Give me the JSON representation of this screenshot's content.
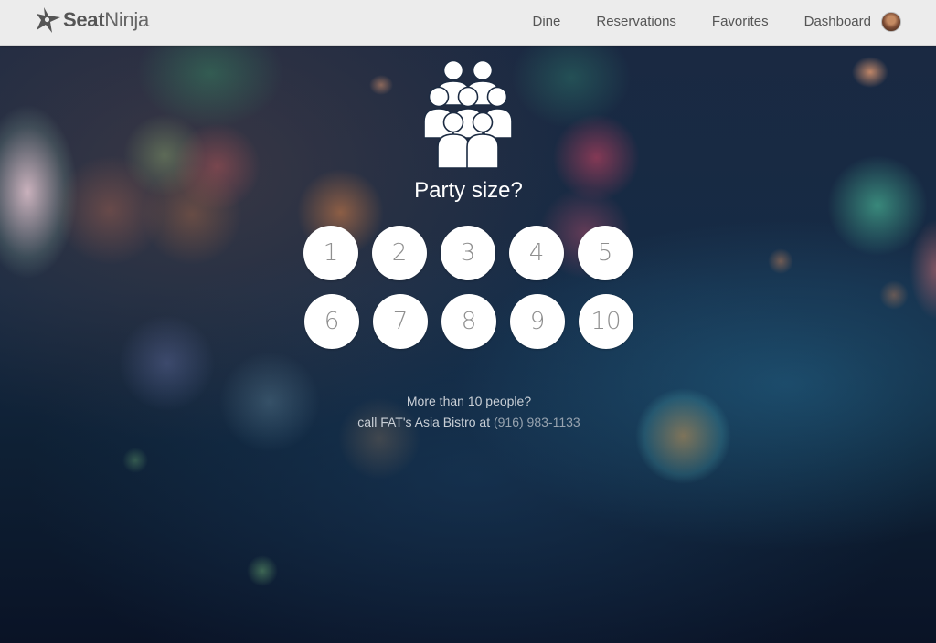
{
  "nav": {
    "logo": {
      "word_bold": "Seat",
      "word_light": "Ninja"
    },
    "items": [
      {
        "label": "Dine"
      },
      {
        "label": "Reservations"
      },
      {
        "label": "Favorites"
      },
      {
        "label": "Dashboard"
      }
    ]
  },
  "main": {
    "icon": "people-group-icon",
    "title": "Party size?",
    "party_sizes": [
      "1",
      "2",
      "3",
      "4",
      "5",
      "6",
      "7",
      "8",
      "9",
      "10"
    ],
    "more_text": "More than 10 people?",
    "call_prefix": "call FAT's Asia Bistro at",
    "phone": "(916) 983-1133"
  },
  "colors": {
    "topbar_bg": "#ececec",
    "button_bg": "#ffffff",
    "button_text": "#8f8f8f",
    "phone_link": "#97a3af"
  }
}
